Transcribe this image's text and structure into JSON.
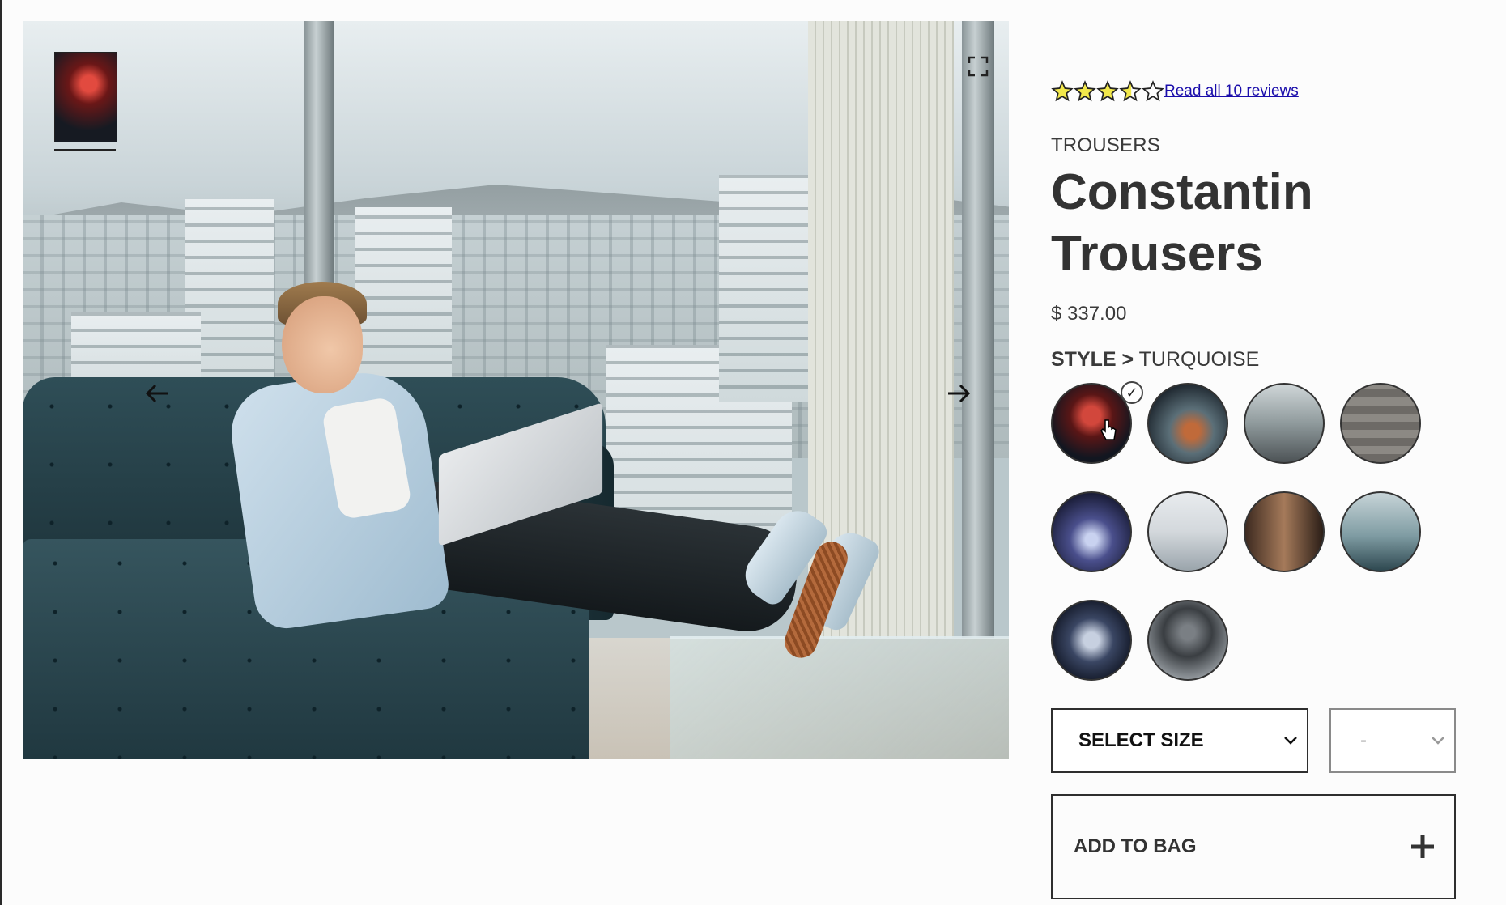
{
  "gallery": {
    "main_image_alt": "Man on sofa with laptop by window",
    "prev_icon": "arrow-left-icon",
    "next_icon": "arrow-right-icon",
    "expand_icon": "fullscreen-icon"
  },
  "product": {
    "rating": 3.5,
    "rating_max": 5,
    "reviews_link": "Read all 10 reviews",
    "category": "TROUSERS",
    "name_line1": "Constantin",
    "name_line2": "Trousers",
    "price": "$ 337.00",
    "style_label": "STYLE >",
    "style_value": "TURQUOISE"
  },
  "styles": [
    {
      "name": "style-1",
      "selected": true
    },
    {
      "name": "style-2",
      "selected": false
    },
    {
      "name": "style-3",
      "selected": false
    },
    {
      "name": "style-4",
      "selected": false
    },
    {
      "name": "style-5",
      "selected": false
    },
    {
      "name": "style-6",
      "selected": false
    },
    {
      "name": "style-7",
      "selected": false
    },
    {
      "name": "style-8",
      "selected": false
    },
    {
      "name": "style-9",
      "selected": false
    },
    {
      "name": "style-10",
      "selected": false
    }
  ],
  "controls": {
    "size_select": "SELECT SIZE",
    "qty_select": "-",
    "add_to_bag": "ADD TO BAG",
    "check_mark": "✓"
  },
  "colors": {
    "link": "#1a0dab",
    "star_fill": "#f2e84b",
    "text": "#3a3a3a"
  }
}
